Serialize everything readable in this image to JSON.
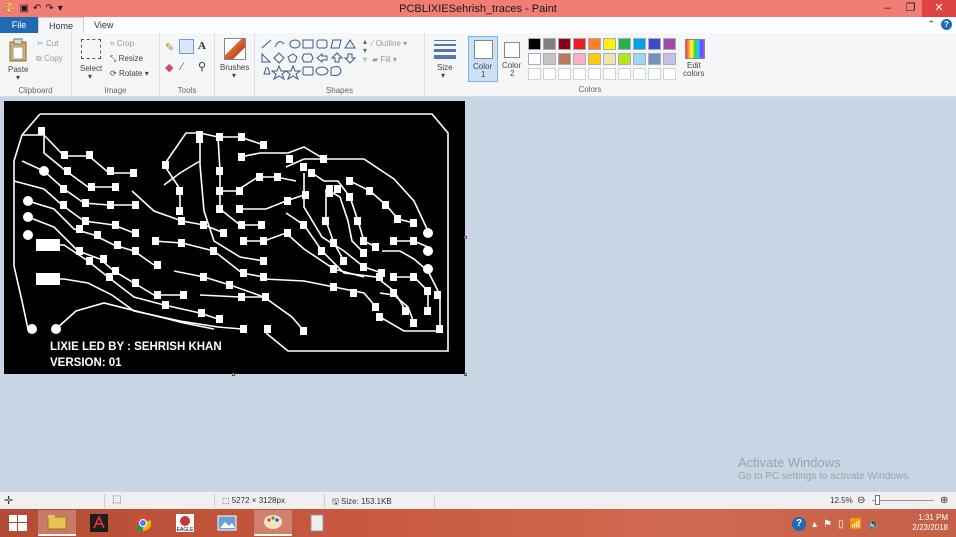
{
  "window": {
    "title": "PCBLIXIESehrish_traces - Paint",
    "controls": {
      "minimize": "–",
      "maximize": "❐",
      "close": "✕"
    }
  },
  "tabs": [
    "File",
    "Home",
    "View"
  ],
  "ribbon": {
    "clipboard": {
      "paste": "Paste",
      "cut": "Cut",
      "copy": "Copy",
      "label": "Clipboard"
    },
    "image": {
      "select": "Select",
      "crop": "Crop",
      "resize": "Resize",
      "rotate": "Rotate",
      "label": "Image"
    },
    "tools": {
      "label": "Tools"
    },
    "brushes": {
      "label": "Brushes"
    },
    "shapes": {
      "outline": "Outline",
      "fill": "Fill",
      "label": "Shapes"
    },
    "size": {
      "label": "Size"
    },
    "color1": {
      "line1": "Color",
      "line2": "1"
    },
    "color2": {
      "line1": "Color",
      "line2": "2"
    },
    "colors": {
      "label": "Colors",
      "edit_line1": "Edit",
      "edit_line2": "colors",
      "row1": [
        "#000000",
        "#7f7f7f",
        "#880015",
        "#ed1c24",
        "#ff7f27",
        "#fff200",
        "#22b14c",
        "#00a2e8",
        "#3f48cc",
        "#a349a4"
      ],
      "row2": [
        "#ffffff",
        "#c3c3c3",
        "#b97a57",
        "#ffaec9",
        "#ffc90e",
        "#efe4b0",
        "#b5e61d",
        "#99d9ea",
        "#7092be",
        "#c8bfe7"
      ]
    }
  },
  "canvas": {
    "text_line1": "LIXIE LED BY : SEHRISH KHAN",
    "text_line2": "VERSION: 01"
  },
  "watermark": {
    "line1": "Activate Windows",
    "line2": "Go to PC settings to activate Windows."
  },
  "status": {
    "dimensions": "5272 × 3128px",
    "size": "Size: 153.1KB",
    "zoom": "12.5%",
    "zoom_level": 0.125
  },
  "taskbar": {
    "time": "1:31 PM",
    "date": "2/23/2018",
    "apps": [
      "start-button",
      "file-explorer",
      "acrobat-reader",
      "chrome",
      "eagle",
      "photos",
      "paint",
      "documents"
    ]
  }
}
